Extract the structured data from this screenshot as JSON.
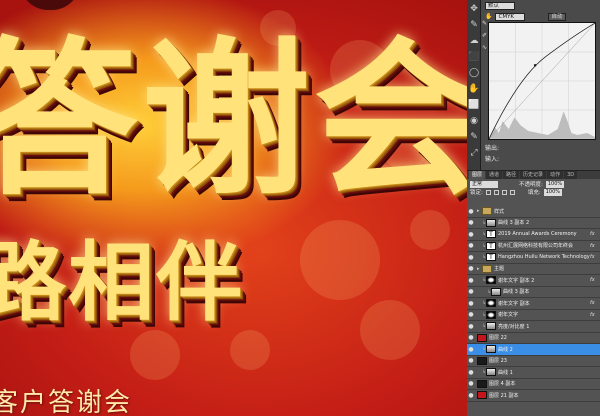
{
  "canvas": {
    "main_text": "答谢会",
    "sub_text": "路相伴",
    "bottom_text": "客户答谢会"
  },
  "tools": [
    "✥",
    "✎",
    "☁",
    "⬛",
    "◯",
    "✋",
    "⬜",
    "◉",
    "✎",
    "⤢"
  ],
  "curves": {
    "preset": "默认",
    "channel": "CMYK",
    "auto_label": "自动",
    "output_label": "输出:",
    "input_label": "输入:"
  },
  "layers_panel": {
    "tabs": [
      "图层",
      "通道",
      "路径",
      "历史记录",
      "动作",
      "3D"
    ],
    "blend_mode": "正常",
    "opacity_label": "不透明度:",
    "opacity_value": "100%",
    "lock_label": "锁定:",
    "fill_label": "填充:",
    "fill_value": "100%",
    "layers": [
      {
        "name": "样式",
        "kind": "folder",
        "depth": 0,
        "fx": false,
        "selected": false
      },
      {
        "name": "曲线 3 副本 2",
        "kind": "grad",
        "depth": 1,
        "fx": false,
        "selected": false
      },
      {
        "name": "2019 Annual Awards Ceremony",
        "kind": "text",
        "depth": 1,
        "fx": true,
        "selected": false
      },
      {
        "name": "杭州汇展网络科技有限公司年终会",
        "kind": "text",
        "depth": 1,
        "fx": true,
        "selected": false
      },
      {
        "name": "Hangzhou Huilu Network Technology ...",
        "kind": "text",
        "depth": 1,
        "fx": true,
        "selected": false
      },
      {
        "name": "主题",
        "kind": "folder",
        "depth": 0,
        "fx": false,
        "selected": false
      },
      {
        "name": "谢年文字 副本 2",
        "kind": "mask",
        "depth": 1,
        "fx": true,
        "selected": false
      },
      {
        "name": "曲线 3 副本",
        "kind": "grad",
        "depth": 2,
        "fx": false,
        "selected": false
      },
      {
        "name": "谢年文字 副本",
        "kind": "mask",
        "depth": 1,
        "fx": true,
        "selected": false
      },
      {
        "name": "谢年文字",
        "kind": "mask",
        "depth": 1,
        "fx": true,
        "selected": false
      },
      {
        "name": "亮度/对比度 1",
        "kind": "grad",
        "depth": 1,
        "fx": false,
        "selected": false
      },
      {
        "name": "图层 22",
        "kind": "red",
        "depth": 0,
        "fx": false,
        "selected": false
      },
      {
        "name": "曲线 2",
        "kind": "grad",
        "depth": 1,
        "fx": false,
        "selected": true
      },
      {
        "name": "图层 23",
        "kind": "dark",
        "depth": 0,
        "fx": false,
        "selected": false
      },
      {
        "name": "曲线 1",
        "kind": "grad",
        "depth": 1,
        "fx": false,
        "selected": false
      },
      {
        "name": "图层 4 副本",
        "kind": "dark",
        "depth": 0,
        "fx": false,
        "selected": false
      },
      {
        "name": "图层 21 副本",
        "kind": "red",
        "depth": 0,
        "fx": false,
        "selected": false
      }
    ]
  }
}
